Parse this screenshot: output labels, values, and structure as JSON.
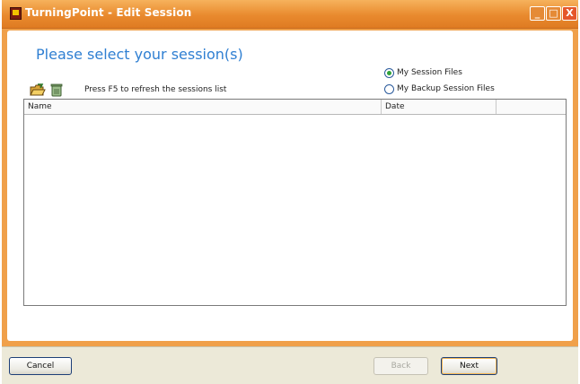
{
  "window": {
    "title": "TurningPoint - Edit Session",
    "controls": {
      "minimize": "_",
      "maximize": "□",
      "close": "X"
    }
  },
  "main": {
    "heading": "Please select your session(s)",
    "source_options": [
      {
        "label": "My Session Files",
        "selected": true
      },
      {
        "label": "My Backup Session Files",
        "selected": false
      }
    ],
    "toolbar": {
      "open_icon": "open-folder-icon",
      "recycle_icon": "recycle-icon",
      "refresh_hint": "Press F5 to refresh the sessions list"
    },
    "session_list": {
      "columns": [
        "Name",
        "Date",
        ""
      ],
      "rows": []
    }
  },
  "footer": {
    "cancel_label": "Cancel",
    "back_label": "Back",
    "next_label": "Next",
    "back_enabled": false
  },
  "colors": {
    "title_bar": "#e98a2e",
    "heading_text": "#2f7fd2",
    "window_frame": "#f0a04a"
  }
}
